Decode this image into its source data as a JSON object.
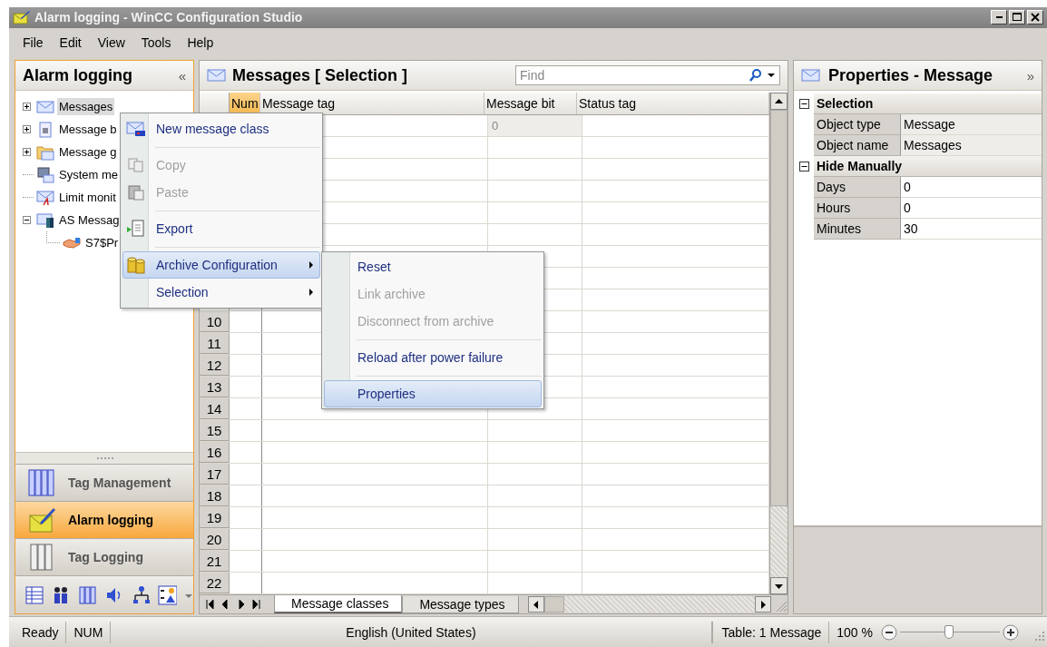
{
  "window": {
    "title": "Alarm logging - WinCC Configuration Studio"
  },
  "menu": [
    "File",
    "Edit",
    "View",
    "Tools",
    "Help"
  ],
  "navigation": {
    "title": "Alarm logging",
    "collapse": "«",
    "tree": [
      {
        "label": "Messages",
        "kind": "envelope",
        "selected": true,
        "expanded": false
      },
      {
        "label": "Message b",
        "kind": "blocks",
        "selected": false,
        "expanded": false
      },
      {
        "label": "Message g",
        "kind": "folder",
        "selected": false,
        "expanded": false
      },
      {
        "label": "System me",
        "kind": "computer",
        "selected": false
      },
      {
        "label": "Limit monit",
        "kind": "limit",
        "selected": false
      },
      {
        "label": "AS Messag",
        "kind": "plc",
        "selected": false,
        "expanded": true,
        "children": [
          {
            "label": "S7$Pr",
            "kind": "handshake",
            "selected": false
          }
        ]
      }
    ],
    "editors": [
      {
        "label": "Tag Management",
        "kind": "tags",
        "selected": false
      },
      {
        "label": "Alarm logging",
        "kind": "alarm",
        "selected": true
      },
      {
        "label": "Tag Logging",
        "kind": "logging",
        "selected": false
      }
    ]
  },
  "messages_panel": {
    "title": "Messages [ Selection ]",
    "search": {
      "placeholder": "Find"
    },
    "table": {
      "columns": [
        {
          "label": "Num",
          "selected": true
        },
        {
          "label": "Message tag",
          "selected": false
        },
        {
          "label": "Message bit",
          "selected": false
        },
        {
          "label": "Status tag",
          "selected": false
        }
      ],
      "first_row": {
        "message_bit": "0"
      },
      "row_numbers": [
        "10",
        "11",
        "12",
        "13",
        "14",
        "15",
        "16",
        "17",
        "18",
        "19",
        "20",
        "21",
        "22"
      ]
    },
    "sheet_tabs": [
      {
        "label": "Message classes",
        "selected": true
      },
      {
        "label": "Message types",
        "selected": false
      }
    ]
  },
  "context_menu": {
    "items": [
      {
        "kind": "new",
        "label": "New message class",
        "disabled": false,
        "highlighted": false,
        "submenu": false
      },
      {
        "kind": "separator"
      },
      {
        "kind": "copy",
        "label": "Copy",
        "disabled": true,
        "highlighted": false,
        "submenu": false
      },
      {
        "kind": "paste",
        "label": "Paste",
        "disabled": true,
        "highlighted": false,
        "submenu": false
      },
      {
        "kind": "separator"
      },
      {
        "kind": "export",
        "label": "Export",
        "disabled": false,
        "highlighted": false,
        "submenu": false
      },
      {
        "kind": "separator"
      },
      {
        "kind": "archive",
        "label": "Archive Configuration",
        "disabled": false,
        "highlighted": true,
        "submenu": true
      },
      {
        "kind": "plain",
        "label": "Selection",
        "disabled": false,
        "highlighted": false,
        "submenu": true
      }
    ]
  },
  "submenu": {
    "items": [
      {
        "kind": "item",
        "label": "Reset",
        "disabled": false,
        "highlighted": false
      },
      {
        "kind": "item",
        "label": "Link archive",
        "disabled": true,
        "highlighted": false
      },
      {
        "kind": "item",
        "label": "Disconnect from archive",
        "disabled": true,
        "highlighted": false
      },
      {
        "kind": "separator"
      },
      {
        "kind": "item",
        "label": "Reload after power failure",
        "disabled": false,
        "highlighted": false
      },
      {
        "kind": "separator"
      },
      {
        "kind": "item",
        "label": "Properties",
        "disabled": false,
        "highlighted": true
      }
    ]
  },
  "properties": {
    "title": "Properties - Message",
    "expand": "»",
    "groups": [
      {
        "label": "Selection",
        "expanded": true,
        "rows": [
          {
            "name": "Object type",
            "value": "Message",
            "read_only": true
          },
          {
            "name": "Object name",
            "value": "Messages",
            "read_only": true
          }
        ]
      },
      {
        "label": "Hide Manually",
        "expanded": true,
        "rows": [
          {
            "name": "Days",
            "value": "0",
            "read_only": false
          },
          {
            "name": "Hours",
            "value": "0",
            "read_only": false
          },
          {
            "name": "Minutes",
            "value": "30",
            "read_only": false
          }
        ]
      }
    ]
  },
  "status_bar": {
    "ready": "Ready",
    "num": "NUM",
    "language": "English (United States)",
    "table": "Table: 1 Message",
    "zoom": "100 %",
    "zoom_slider": {
      "level": 0.49
    }
  }
}
